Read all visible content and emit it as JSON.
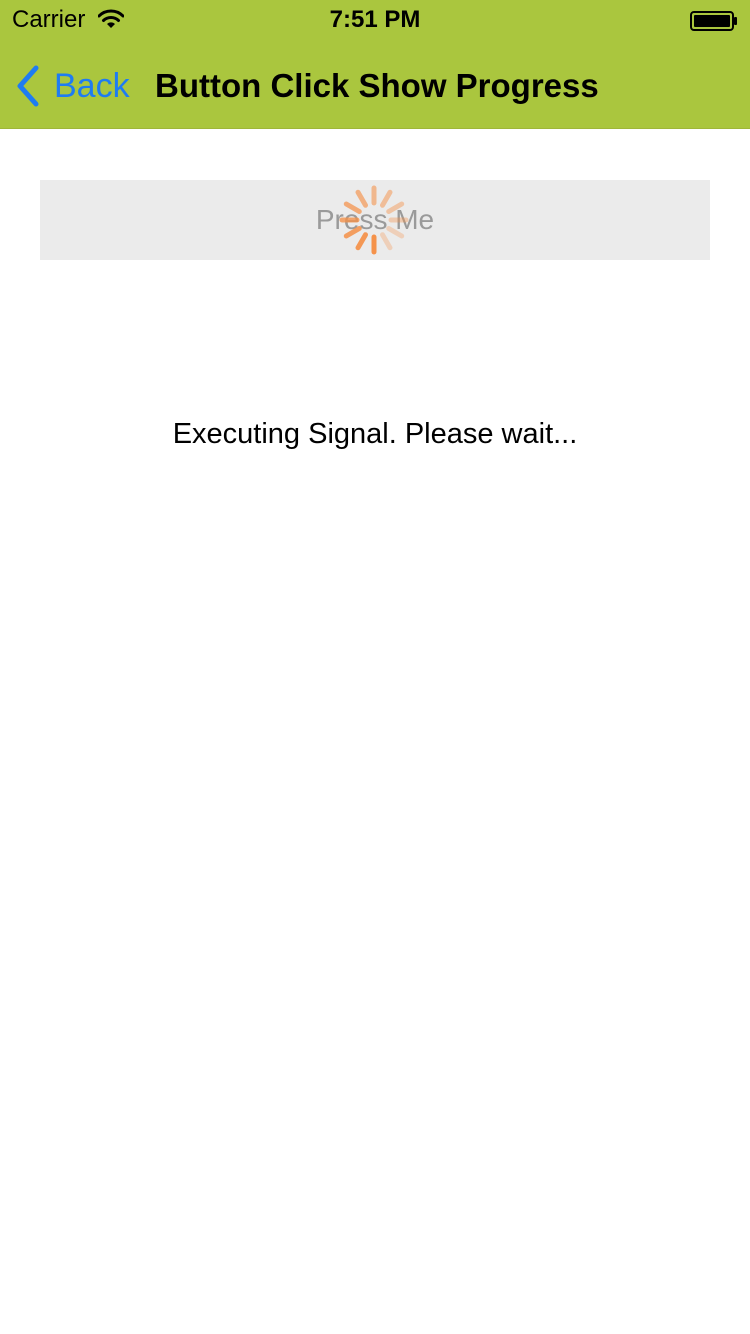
{
  "colors": {
    "nav_background": "#aac63e",
    "back_tint": "#1e7cf2",
    "spinner": "#f5924a"
  },
  "status_bar": {
    "carrier": "Carrier",
    "time": "7:51 PM",
    "wifi_icon": "wifi-icon",
    "battery_icon": "battery-icon"
  },
  "nav": {
    "back_label": "Back",
    "back_icon": "chevron-left-icon",
    "title": "Button Click Show Progress"
  },
  "main": {
    "button_label": "Press Me",
    "spinner_icon": "activity-spinner-icon",
    "message": "Executing Signal. Please wait..."
  }
}
